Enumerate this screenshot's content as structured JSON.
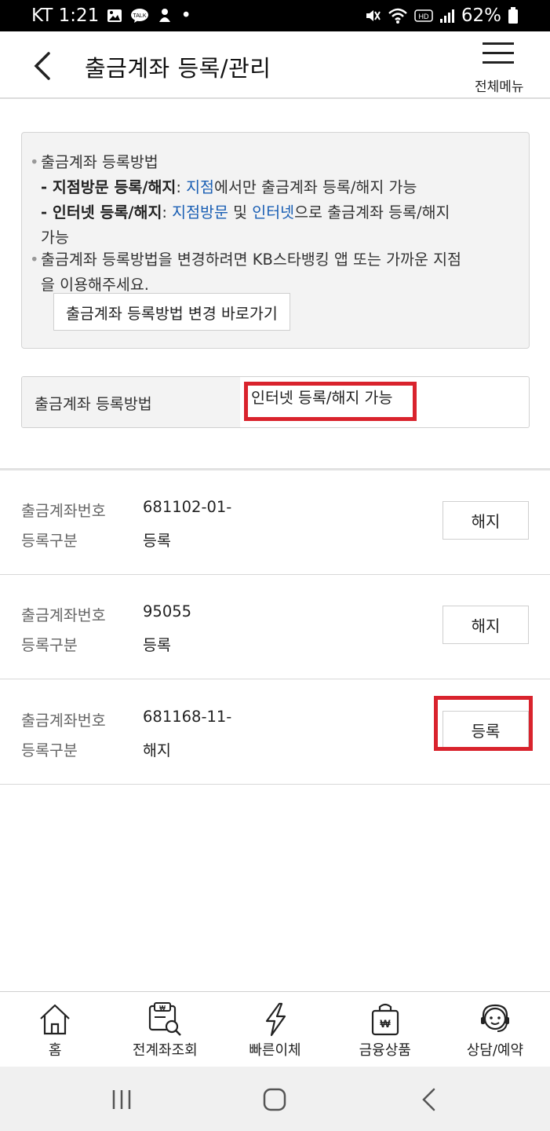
{
  "status_bar": {
    "carrier_time": "KT 1:21",
    "dot": "•",
    "battery": "62%",
    "icons": [
      "image-icon",
      "talk-icon",
      "ai-icon",
      "mute-icon",
      "wifi-icon",
      "hd-icon",
      "signal-icon",
      "battery-icon"
    ]
  },
  "header": {
    "title": "출금계좌 등록/관리",
    "menu_label": "전체메뉴"
  },
  "info": {
    "item1_title": "출금계좌 등록방법",
    "line2_prefix": "- ",
    "line2_bold": "지점방문 등록/해지",
    "line2_colon": ": ",
    "line2_link": "지점",
    "line2_rest": "에서만 출금계좌 등록/해지 가능",
    "line3_prefix": "- ",
    "line3_bold": "인터넷 등록/해지",
    "line3_colon": ": ",
    "line3_link1": "지점방문",
    "line3_mid": " 및 ",
    "line3_link2": "인터넷",
    "line3_rest": "으로 출금계좌 등록/해지",
    "line4": "가능",
    "item2_line1": "출금계좌 등록방법을 변경하려면 KB스타뱅킹 앱 또는 가까운 지점",
    "item2_line2": "을 이용해주세요.",
    "shortcut_button": "출금계좌 등록방법 변경 바로가기"
  },
  "method": {
    "label": "출금계좌 등록방법",
    "value": "인터넷 등록/해지 가능"
  },
  "accounts": [
    {
      "account_label": "출금계좌번호",
      "account_number": "681102-01-",
      "type_label": "등록구분",
      "type_value": "등록",
      "action": "해지"
    },
    {
      "account_label": "출금계좌번호",
      "account_number": "95055",
      "type_label": "등록구분",
      "type_value": "등록",
      "action": "해지"
    },
    {
      "account_label": "출금계좌번호",
      "account_number": "681168-11-",
      "type_label": "등록구분",
      "type_value": "해지",
      "action": "등록"
    }
  ],
  "bottom_nav": [
    {
      "label": "홈",
      "icon": "home-icon"
    },
    {
      "label": "전계좌조회",
      "icon": "account-search-icon"
    },
    {
      "label": "빠른이체",
      "icon": "lightning-icon"
    },
    {
      "label": "금융상품",
      "icon": "shopping-bag-icon"
    },
    {
      "label": "상담/예약",
      "icon": "support-agent-icon"
    }
  ],
  "colors": {
    "link": "#1a5fb4",
    "highlight": "#d9232d",
    "info_bg": "#f3f3f3"
  }
}
